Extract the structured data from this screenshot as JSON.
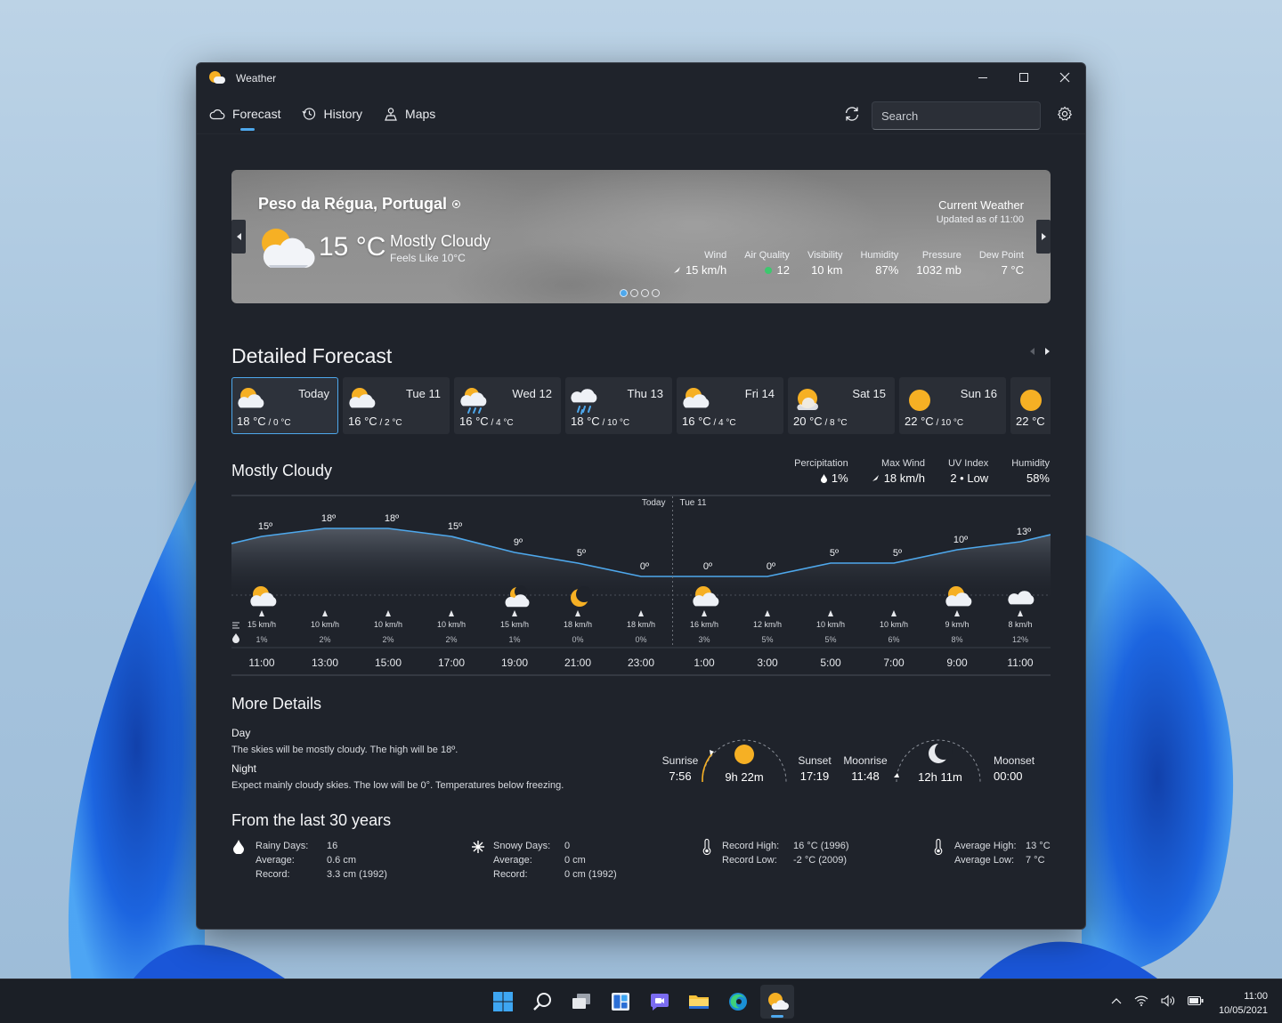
{
  "app": {
    "title": "Weather"
  },
  "nav": {
    "tabs": [
      {
        "label": "Forecast"
      },
      {
        "label": "History"
      },
      {
        "label": "Maps"
      }
    ],
    "search_placeholder": "Search"
  },
  "current": {
    "location": "Peso da Régua, Portugal",
    "temp": "15 °C",
    "condition": "Mostly Cloudy",
    "feels_like": "Feels Like 10°C",
    "header": "Current Weather",
    "updated": "Updated as of 11:00",
    "metrics": [
      {
        "label": "Wind",
        "value": "15 km/h"
      },
      {
        "label": "Air Quality",
        "value": "12"
      },
      {
        "label": "Visibility",
        "value": "10 km"
      },
      {
        "label": "Humidity",
        "value": "87%"
      },
      {
        "label": "Pressure",
        "value": "1032 mb"
      },
      {
        "label": "Dew Point",
        "value": "7 °C"
      }
    ],
    "carousel_pages": 4,
    "carousel_active": 1
  },
  "forecast": {
    "title": "Detailed Forecast",
    "days": [
      {
        "name": "Today",
        "high": "18 °C",
        "low": "0 °C",
        "icon": "partly-cloudy-icon"
      },
      {
        "name": "Tue 11",
        "high": "16 °C",
        "low": "2 °C",
        "icon": "partly-cloudy-icon"
      },
      {
        "name": "Wed 12",
        "high": "16 °C",
        "low": "4 °C",
        "icon": "showers-icon"
      },
      {
        "name": "Thu 13",
        "high": "18 °C",
        "low": "10 °C",
        "icon": "rain-icon"
      },
      {
        "name": "Fri 14",
        "high": "16 °C",
        "low": "4 °C",
        "icon": "partly-cloudy-icon"
      },
      {
        "name": "Sat 15",
        "high": "20 °C",
        "low": "8 °C",
        "icon": "mostly-sunny-icon"
      },
      {
        "name": "Sun 16",
        "high": "22 °C",
        "low": "10 °C",
        "icon": "sunny-icon"
      },
      {
        "name": "",
        "high": "22 °C",
        "low": "",
        "icon": "sunny-icon"
      }
    ]
  },
  "day_summary": {
    "condition": "Mostly Cloudy",
    "stats": [
      {
        "label": "Percipitation",
        "value": "1%"
      },
      {
        "label": "Max Wind",
        "value": "18 km/h"
      },
      {
        "label": "UV Index",
        "value": "2 • Low"
      },
      {
        "label": "Humidity",
        "value": "58%"
      }
    ]
  },
  "hourly": {
    "day_labels": {
      "left": "Today",
      "right": "Tue 11"
    },
    "curve_temps": [
      15,
      18,
      18,
      15,
      9,
      5,
      0,
      0,
      0,
      5,
      5,
      10,
      13
    ],
    "temps": [
      "15º",
      "18º",
      "18º",
      "15º",
      "9º",
      "5º",
      "0º",
      "0º",
      "0º",
      "5º",
      "5º",
      "10º",
      "13º"
    ],
    "icons": [
      "partly-cloudy-icon",
      "",
      "",
      "",
      "partly-cloudy-night-icon",
      "moon-icon",
      "",
      "partly-cloudy-icon",
      "",
      "",
      "",
      "partly-cloudy-icon",
      "cloud-icon"
    ],
    "wind": [
      "15 km/h",
      "10 km/h",
      "10 km/h",
      "10 km/h",
      "15 km/h",
      "18 km/h",
      "18 km/h",
      "16 km/h",
      "12 km/h",
      "10 km/h",
      "10 km/h",
      "9 km/h",
      "8 km/h"
    ],
    "precip": [
      "1%",
      "2%",
      "2%",
      "2%",
      "1%",
      "0%",
      "0%",
      "3%",
      "5%",
      "5%",
      "6%",
      "8%",
      "12%"
    ],
    "times": [
      "11:00",
      "13:00",
      "15:00",
      "17:00",
      "19:00",
      "21:00",
      "23:00",
      "1:00",
      "3:00",
      "5:00",
      "7:00",
      "9:00",
      "11:00"
    ]
  },
  "details": {
    "title": "More Details",
    "day_label": "Day",
    "day_text": "The skies will be mostly cloudy. The high will be 18º.",
    "night_label": "Night",
    "night_text": "Expect mainly cloudy skies. The low will be 0°. Temperatures below freezing.",
    "sunrise_label": "Sunrise",
    "sunrise": "7:56",
    "daylight": "9h 22m",
    "sunset_label": "Sunset",
    "sunset": "17:19",
    "moonrise_label": "Moonrise",
    "moonrise": "11:48",
    "moonlight": "12h 11m",
    "moonset_label": "Moonset",
    "moonset": "00:00"
  },
  "history": {
    "title": "From the last 30 years",
    "rain": {
      "days_label": "Rainy Days:",
      "days": "16",
      "avg_label": "Average:",
      "avg": "0.6 cm",
      "rec_label": "Record:",
      "rec": "3.3 cm (1992)"
    },
    "snow": {
      "days_label": "Snowy Days:",
      "days": "0",
      "avg_label": "Average:",
      "avg": "0 cm",
      "rec_label": "Record:",
      "rec": "0 cm (1992)"
    },
    "records": {
      "high_label": "Record High:",
      "high": "16 °C (1996)",
      "low_label": "Record Low:",
      "low": "-2 °C (2009)"
    },
    "averages": {
      "high_label": "Average High:",
      "high": "13 °C",
      "low_label": "Average Low:",
      "low": "7 °C"
    }
  },
  "taskbar": {
    "time": "11:00",
    "date": "10/05/2021"
  }
}
